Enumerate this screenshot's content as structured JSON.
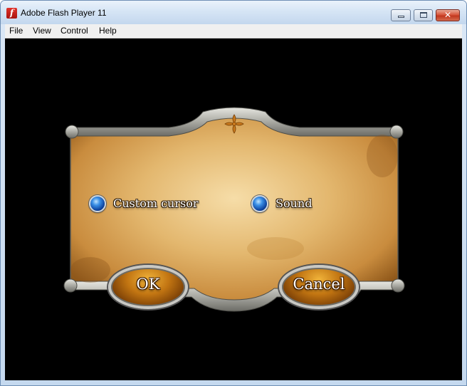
{
  "window": {
    "title": "Adobe Flash Player 11",
    "icon": "flash-player-icon",
    "icon_glyph": "f",
    "controls": {
      "minimize_icon": "minimize-icon",
      "maximize_icon": "maximize-icon",
      "close_icon": "close-icon",
      "close_glyph": "✕"
    }
  },
  "menu": {
    "items": [
      {
        "label": "File"
      },
      {
        "label": "View"
      },
      {
        "label": "Control"
      },
      {
        "label": "Help"
      }
    ]
  },
  "dialog": {
    "options": [
      {
        "label": "Custom cursor",
        "selected": true
      },
      {
        "label": "Sound",
        "selected": true
      }
    ],
    "ok_label": "OK",
    "cancel_label": "Cancel",
    "emblem_icon": "fleur-de-lis-icon"
  },
  "colors": {
    "stage_background": "#000000",
    "parchment": "#d9a75a",
    "frame_metal": "#b9b9b2",
    "radio_blue": "#1f63c9",
    "button_gold": "#c27512",
    "close_red": "#c2381f"
  }
}
